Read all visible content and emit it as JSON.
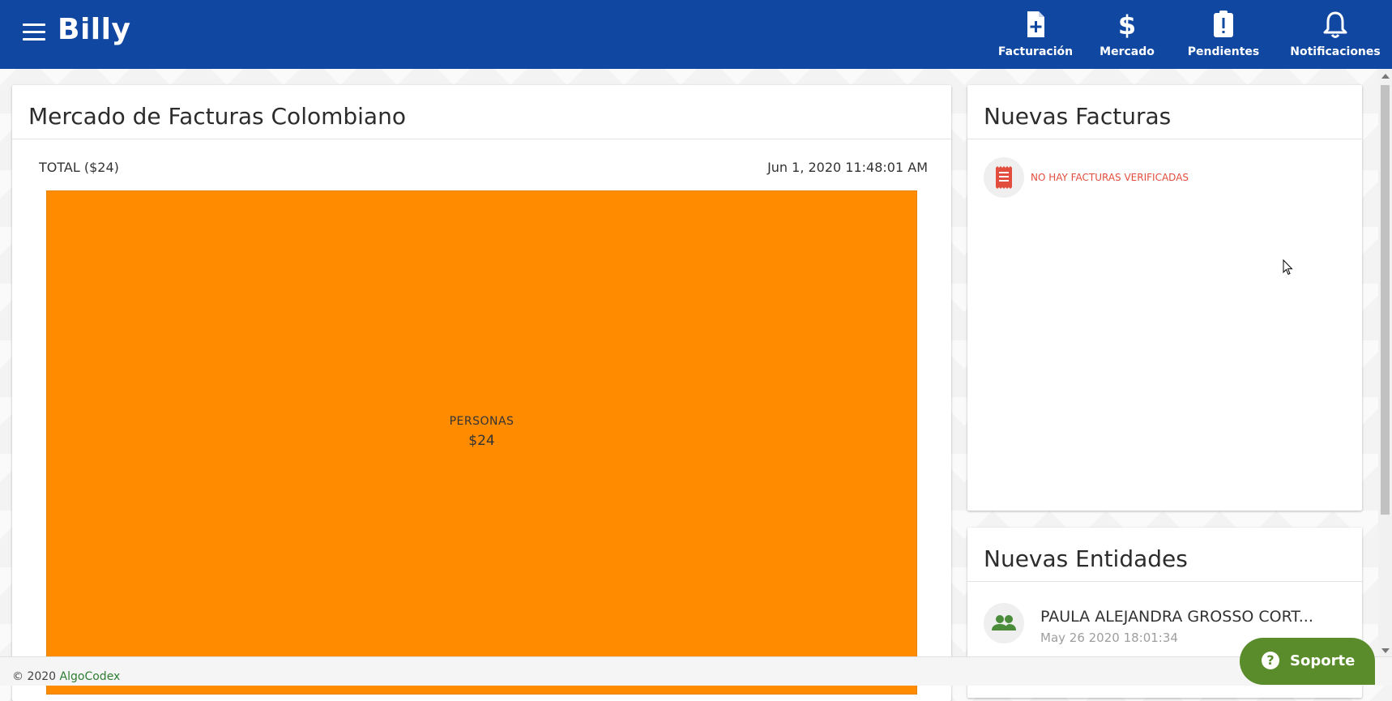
{
  "app": {
    "brand": "Billy"
  },
  "topnav": {
    "items": [
      {
        "label": "Facturación",
        "icon": "file-plus-icon"
      },
      {
        "label": "Mercado",
        "icon": "dollar-icon"
      },
      {
        "label": "Pendientes",
        "icon": "clipboard-alert-icon"
      },
      {
        "label": "Notificaciones",
        "icon": "bell-icon"
      }
    ]
  },
  "market": {
    "title": "Mercado de Facturas Colombiano",
    "total": "TOTAL ($24)",
    "timestamp": "Jun 1, 2020 11:48:01 AM"
  },
  "chart_data": {
    "type": "treemap",
    "items": [
      {
        "name": "PERSONAS",
        "value": 24,
        "value_label": "$24",
        "color": "#ff8c00"
      }
    ]
  },
  "facturas": {
    "title": "Nuevas Facturas",
    "empty_message": "NO HAY FACTURAS VERIFICADAS",
    "icon": "receipt-icon",
    "icon_color": "#e34d3d"
  },
  "entidades": {
    "title": "Nuevas Entidades",
    "items": [
      {
        "name": "PAULA ALEJANDRA GROSSO CORT...",
        "date": "May 26 2020 18:01:34",
        "icon": "people-icon",
        "icon_color": "#4a8c3a"
      }
    ]
  },
  "footer": {
    "copyright": "© 2020",
    "company": "AlgoCodex"
  },
  "support": {
    "label": "Soporte",
    "icon": "help-circle-icon",
    "color": "#5a8c2b"
  },
  "colors": {
    "primary": "#0f47a1",
    "accent": "#ff8c00"
  }
}
